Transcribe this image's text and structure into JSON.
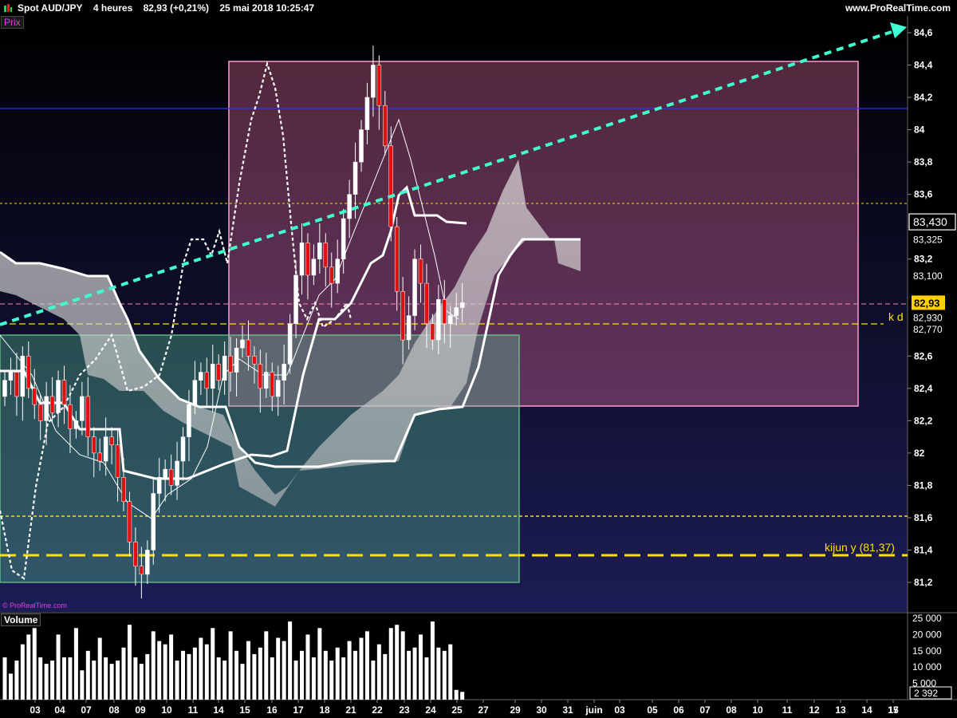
{
  "header": {
    "symbol": "Spot AUD/JPY",
    "timeframe": "4 heures",
    "last": "82,93 (+0,21%)",
    "datetime": "25 mai 2018 10:25:47",
    "site": "www.ProRealTime.com"
  },
  "panel_labels": {
    "price": "Prix",
    "volume": "Volume",
    "credit": "© ProRealTime.com"
  },
  "price_axis": {
    "ticks": [
      "84,6",
      "84,4",
      "84,2",
      "84",
      "83,8",
      "83,6",
      "83,2",
      "82,6",
      "82,4",
      "82,2",
      "82",
      "81,8",
      "81,6",
      "81,4",
      "81,2"
    ],
    "tick_values": [
      84.6,
      84.4,
      84.2,
      84,
      83.8,
      83.6,
      83.2,
      82.6,
      82.4,
      82.2,
      82,
      81.8,
      81.6,
      81.4,
      81.2
    ],
    "badges": [
      {
        "label": "83,430",
        "value": 83.43,
        "style": "white-box"
      },
      {
        "label": "83,325",
        "value": 83.325,
        "style": "plain"
      },
      {
        "label": "83,100",
        "value": 83.1,
        "style": "plain"
      },
      {
        "label": "82,93",
        "value": 82.93,
        "style": "yellow"
      },
      {
        "label": "82,930",
        "value": 82.93,
        "style": "plain-low"
      },
      {
        "label": "82,770",
        "value": 82.77,
        "style": "plain"
      }
    ]
  },
  "volume_axis": {
    "ticks": [
      "25 000",
      "20 000",
      "15 000",
      "10 000",
      "5 000"
    ],
    "tick_values": [
      25000,
      20000,
      15000,
      10000,
      5000
    ],
    "current": "2 392"
  },
  "x_axis": {
    "labels": [
      "03",
      "04",
      "07",
      "08",
      "09",
      "10",
      "11",
      "14",
      "15",
      "16",
      "17",
      "18",
      "21",
      "22",
      "23",
      "24",
      "25",
      "27",
      "29",
      "30",
      "31",
      "juin",
      "03",
      "05",
      "06",
      "07",
      "08",
      "10",
      "11",
      "12",
      "13",
      "14",
      "15",
      "17"
    ]
  },
  "annotations": {
    "kd": "k d",
    "kijun": "kijun y (81,37)"
  },
  "colors": {
    "background_top": "#000000",
    "background_bottom": "#1a1a4a",
    "pink_box": "#ff9ad0",
    "green_box": "#6fd08a",
    "trendline": "#40ffd0",
    "level_yellow": "#ffe000",
    "blue_line": "#3030ff",
    "candle_up": "#ffffff",
    "candle_down": "#e01010",
    "cloud": "#d8d8d8"
  },
  "chart_data": {
    "type": "candlestick",
    "title": "Spot AUD/JPY",
    "ylim": [
      81.1,
      84.68
    ],
    "levels": {
      "blue_resistance": 84.13,
      "yellow_dotted_upper": 83.55,
      "yellow_dashed_kd": 82.8,
      "pink_dashed": 82.93,
      "yellow_dotted_lower": 81.61,
      "kijun_weekly": 81.37
    },
    "zones": [
      {
        "name": "pink",
        "from": "14",
        "to": "14(juin)",
        "y_top": 84.44,
        "y_bottom": 82.3
      },
      {
        "name": "green",
        "from": "03",
        "to": "29",
        "y_top": 82.73,
        "y_bottom": 81.19
      }
    ],
    "trendline": {
      "from": {
        "x": "03",
        "y": 82.8
      },
      "to": {
        "x": "17(juin)",
        "y": 84.64
      }
    },
    "candles_per_day": 6,
    "days": [
      "03",
      "04",
      "07",
      "08",
      "09",
      "10",
      "11",
      "14",
      "15",
      "16",
      "17",
      "18",
      "21",
      "22",
      "23",
      "24",
      "25"
    ],
    "closes": [
      82.45,
      82.5,
      82.35,
      82.6,
      82.4,
      82.3,
      82.2,
      82.35,
      82.25,
      82.45,
      82.3,
      82.15,
      82.2,
      82.35,
      82.1,
      82.0,
      81.95,
      82.1,
      82.05,
      81.85,
      81.7,
      81.45,
      81.3,
      81.25,
      81.4,
      81.75,
      81.85,
      81.9,
      81.8,
      81.95,
      82.1,
      82.3,
      82.45,
      82.5,
      82.4,
      82.55,
      82.45,
      82.6,
      82.5,
      82.65,
      82.7,
      82.6,
      82.55,
      82.4,
      82.5,
      82.35,
      82.45,
      82.55,
      82.8,
      83.1,
      83.3,
      83.1,
      83.2,
      83.3,
      83.15,
      83.05,
      83.2,
      83.45,
      83.6,
      83.8,
      84.0,
      84.2,
      84.4,
      84.15,
      83.9,
      83.4,
      83.0,
      82.7,
      82.85,
      83.2,
      83.05,
      82.8,
      82.7,
      82.95,
      82.8,
      82.85,
      82.9,
      82.93
    ],
    "volume_values": [
      13000,
      8000,
      12000,
      17000,
      20000,
      22000,
      13000,
      11000,
      12000,
      20000,
      13000,
      13000,
      22000,
      9000,
      15000,
      12000,
      19000,
      13000,
      11000,
      12000,
      16000,
      23000,
      13000,
      11000,
      14000,
      21000,
      18000,
      17000,
      20000,
      12000,
      15000,
      14000,
      16000,
      19000,
      17000,
      22000,
      13000,
      12000,
      21000,
      15000,
      11000,
      18000,
      14000,
      16000,
      21000,
      13000,
      19000,
      18000,
      24000,
      12000,
      15000,
      20000,
      13000,
      22000,
      15000,
      12000,
      16000,
      13000,
      18000,
      15000,
      19000,
      21000,
      12000,
      17000,
      14000,
      22000,
      23000,
      21000,
      15000,
      16000,
      20000,
      13000,
      24000,
      16000,
      15000,
      17000,
      3000,
      2392
    ]
  }
}
